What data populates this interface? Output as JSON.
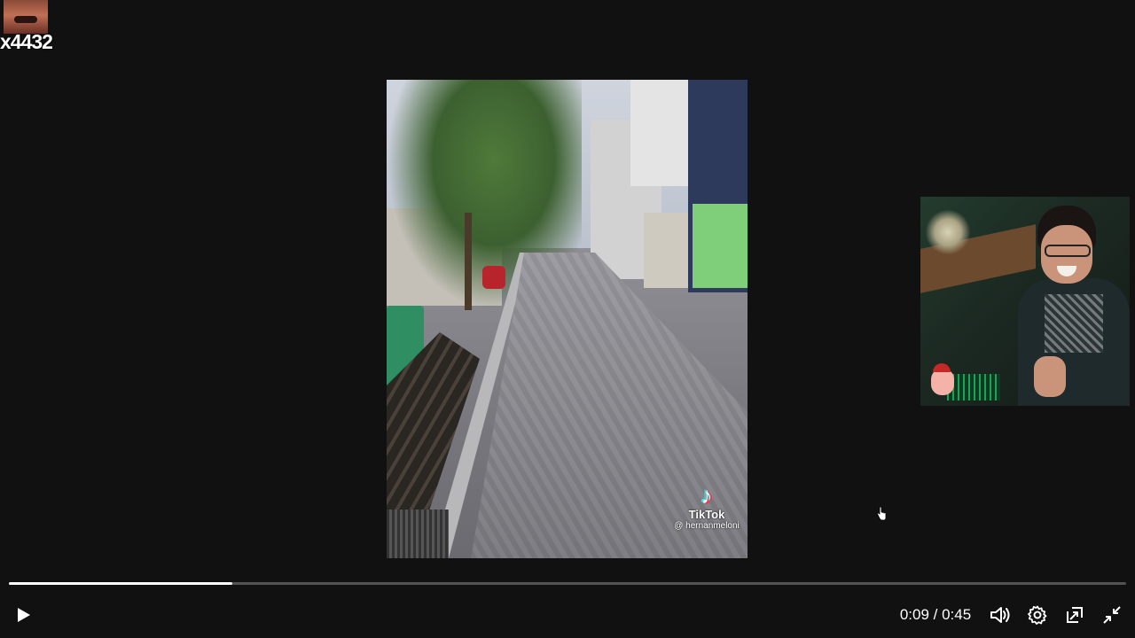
{
  "streamer_badge": {
    "name_fragment": "x4432"
  },
  "video": {
    "watermark": {
      "icon": "tiktok-note-icon",
      "brand": "TikTok",
      "handle": "@ hernanmeloni"
    }
  },
  "webcam_overlay": {
    "description_icon": "streamer-webcam"
  },
  "player": {
    "progress": 0.2,
    "current_time": "0:09",
    "separator": "/",
    "duration": "0:45",
    "time_display": "0:09 / 0:45",
    "controls": {
      "play": "play-icon",
      "volume": "volume-icon",
      "settings": "gear-icon",
      "popout": "popout-icon",
      "exit_fullscreen": "exit-fullscreen-icon"
    },
    "colors": {
      "progress_fill": "#ffffff",
      "track": "#5a5a5a",
      "background": "#111111"
    }
  }
}
